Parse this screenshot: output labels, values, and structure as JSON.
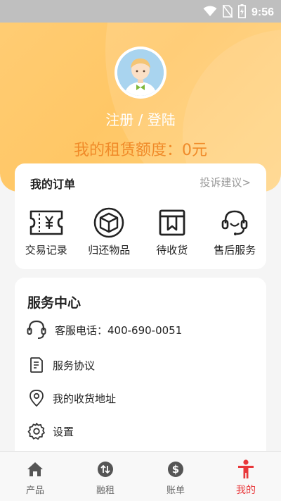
{
  "status_bar": {
    "time": "9:56",
    "icons": [
      "wifi-icon",
      "no-sim-icon",
      "battery-icon"
    ]
  },
  "profile": {
    "login_text": "注册 / 登陆",
    "credit_text": "我的租赁额度：0元"
  },
  "orders": {
    "title": "我的订单",
    "complaint_link": "投诉建议>",
    "items": [
      {
        "label": "交易记录",
        "icon": "ticket-icon"
      },
      {
        "label": "归还物品",
        "icon": "box-icon"
      },
      {
        "label": "待收货",
        "icon": "package-icon"
      },
      {
        "label": "售后服务",
        "icon": "headset-icon"
      }
    ]
  },
  "service_center": {
    "title": "服务中心",
    "items": [
      {
        "label": "客服电话：400-690-0051",
        "icon": "headset-icon"
      },
      {
        "label": "服务协议",
        "icon": "document-icon"
      },
      {
        "label": "我的收货地址",
        "icon": "location-pin-icon"
      },
      {
        "label": "设置",
        "icon": "gear-icon"
      }
    ]
  },
  "tab_bar": {
    "tabs": [
      {
        "label": "产品",
        "icon": "home-icon",
        "active": false
      },
      {
        "label": "融租",
        "icon": "exchange-icon",
        "active": false
      },
      {
        "label": "账单",
        "icon": "dollar-icon",
        "active": false
      },
      {
        "label": "我的",
        "icon": "person-icon",
        "active": true
      }
    ]
  },
  "colors": {
    "header": "#ffc766",
    "accent_orange": "#f08a28",
    "active_tab": "#e8373a"
  }
}
